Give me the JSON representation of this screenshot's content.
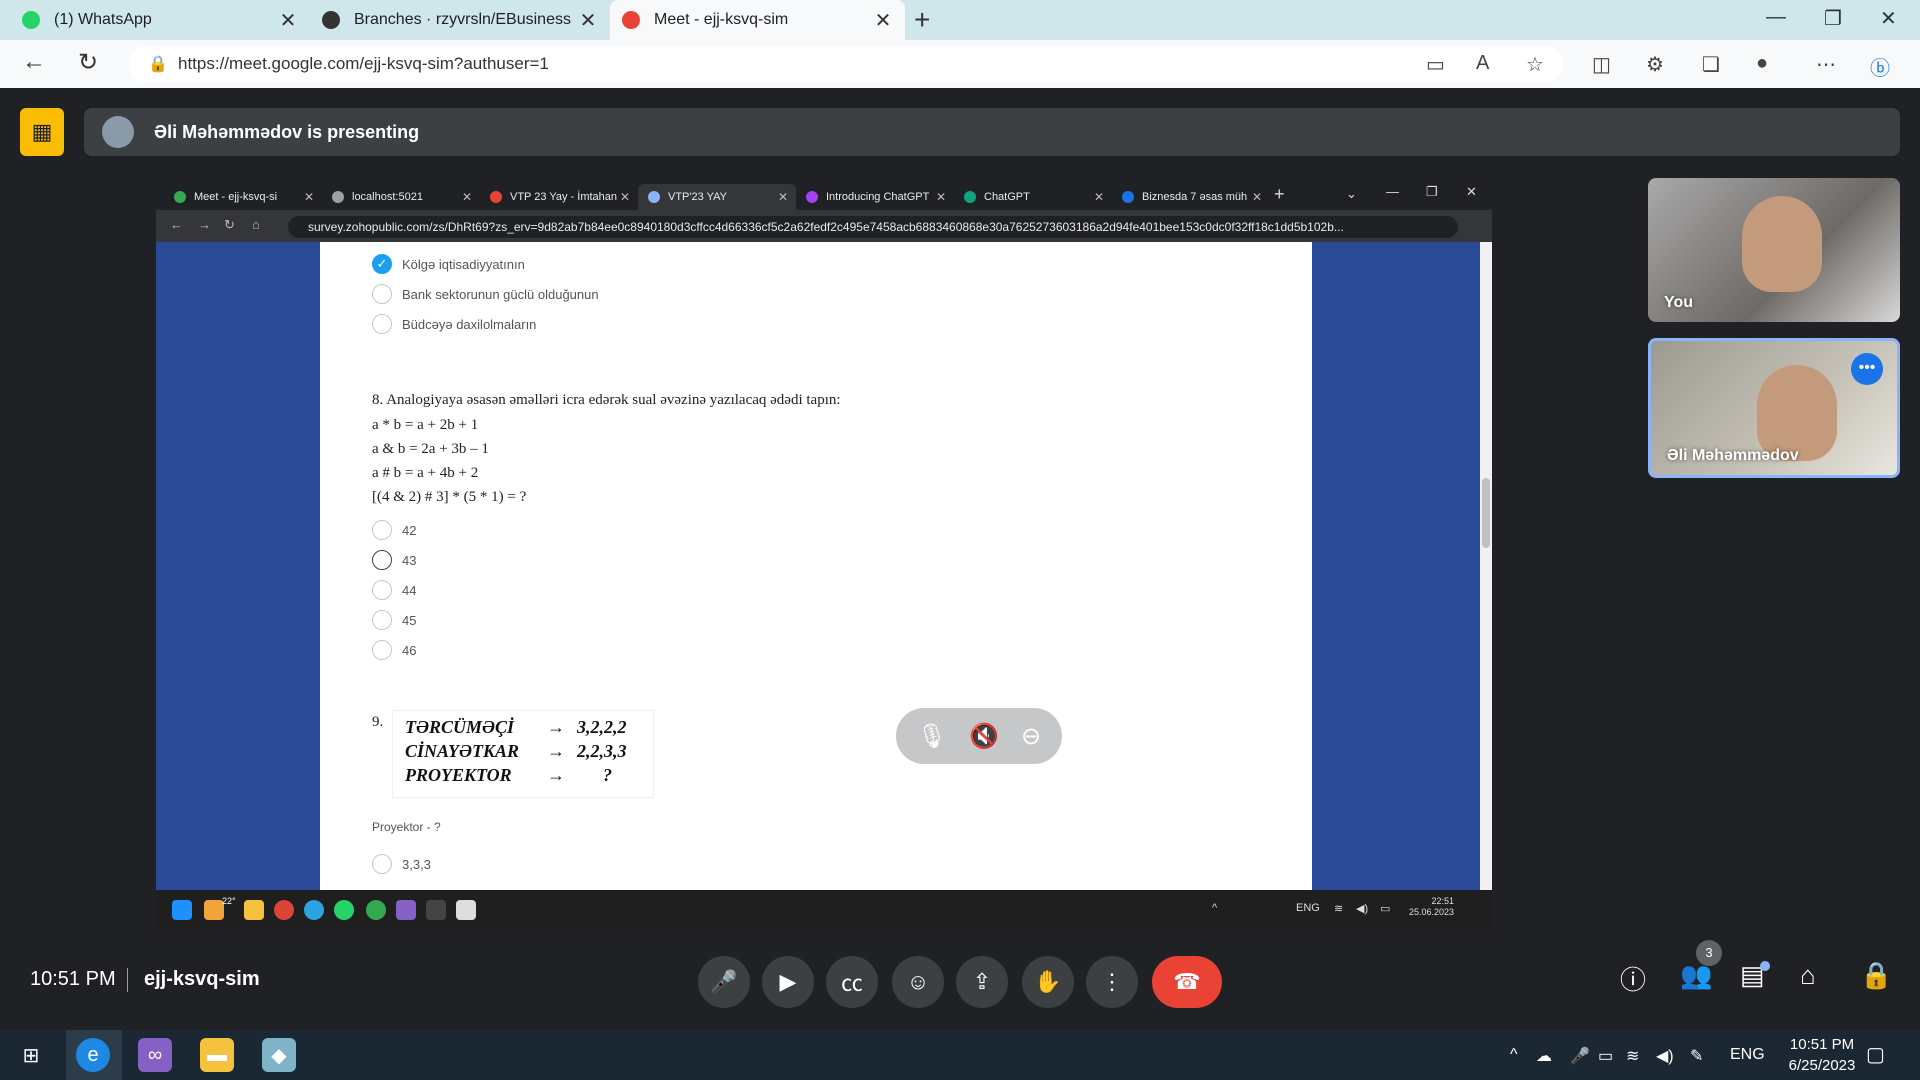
{
  "browser": {
    "tabs": [
      {
        "label": "(1) WhatsApp",
        "icon": "whatsapp-icon",
        "color": "#25d366"
      },
      {
        "label": "Branches · rzyvrsln/EBusiness",
        "icon": "github-icon",
        "color": "#333333"
      },
      {
        "label": "Meet - ejj-ksvq-sim",
        "icon": "meet-icon",
        "color": "#ea4335"
      }
    ],
    "url": "https://meet.google.com/ejj-ksvq-sim?authuser=1"
  },
  "banner": {
    "text": "Əli Məhəmmədov is presenting"
  },
  "shared": {
    "tabs": [
      {
        "label": "Meet - ejj-ksvq-si"
      },
      {
        "label": "localhost:5021"
      },
      {
        "label": "VTP 23 Yay - İmtahan"
      },
      {
        "label": "VTP'23 YAY"
      },
      {
        "label": "Introducing ChatGPT"
      },
      {
        "label": "ChatGPT"
      },
      {
        "label": "Biznesda 7 əsas müh"
      }
    ],
    "url": "survey.zohopublic.com/zs/DhRt69?zs_erv=9d82ab7b84ee0c8940180d3cffcc4d66336cf5c2a62fedf2c495e7458acb6883460868e30a7625273603186a2d94fe401bee153c0dc0f32ff18c1dd5b102b...",
    "prev_options": [
      {
        "label": "Kölgə iqtisadiyyatının",
        "checked": true
      },
      {
        "label": "Bank sektorunun güclü olduğunun",
        "checked": false
      },
      {
        "label": "Büdcəyə daxilolmaların",
        "checked": false
      }
    ],
    "q8": {
      "number": "8.",
      "text": "Analogiyaya əsasən əməlləri icra edərək sual əvəzinə yazılacaq ədədi tapın:",
      "lines": [
        "a * b = a + 2b + 1",
        "a & b = 2a + 3b – 1",
        "a # b = a + 4b + 2",
        "[(4 & 2) # 3]  * (5 *  1) = ?"
      ],
      "options": [
        "42",
        "43",
        "44",
        "45",
        "46"
      ]
    },
    "q9": {
      "number": "9.",
      "rows": [
        {
          "word": "TƏRCÜMƏÇİ",
          "arrow": "→",
          "value": "3,2,2,2"
        },
        {
          "word": "CİNAYƏTKAR",
          "arrow": "→",
          "value": "2,2,3,3"
        },
        {
          "word": "PROYEKTOR",
          "arrow": "→",
          "value": "?"
        }
      ],
      "caption": "Proyektor - ?",
      "options": [
        "3,3,3"
      ]
    },
    "taskbar": {
      "temp": "22°",
      "lang": "ENG",
      "time": "22:51",
      "date": "25.06.2023"
    }
  },
  "tiles": [
    {
      "name": "You"
    },
    {
      "name": "Əli Məhəmmədov"
    }
  ],
  "bottom": {
    "time": "10:51 PM",
    "code": "ejj-ksvq-sim",
    "people_count": "3"
  },
  "windows": {
    "lang": "ENG",
    "time": "10:51 PM",
    "date": "6/25/2023"
  }
}
